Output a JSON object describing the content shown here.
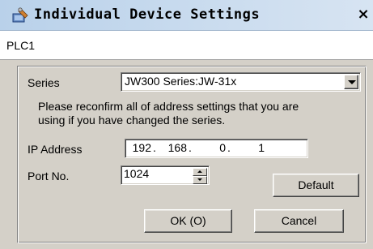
{
  "window": {
    "title": "Individual Device Settings",
    "close_label": "×",
    "title_icon": "settings-wrench-icon"
  },
  "header": {
    "plc_name": "PLC1"
  },
  "form": {
    "series_label": "Series",
    "series_value": "JW300 Series:JW-31x",
    "notice_line1": "Please reconfirm all of address settings that you are",
    "notice_line2": "using if you have changed the series.",
    "ip_label": "IP Address",
    "ip_octets": [
      "192",
      "168",
      "0",
      "1"
    ],
    "ip_separator": ".",
    "port_label": "Port No.",
    "port_value": "1024"
  },
  "buttons": {
    "default_label": "Default",
    "ok_label": "OK (O)",
    "cancel_label": "Cancel"
  }
}
